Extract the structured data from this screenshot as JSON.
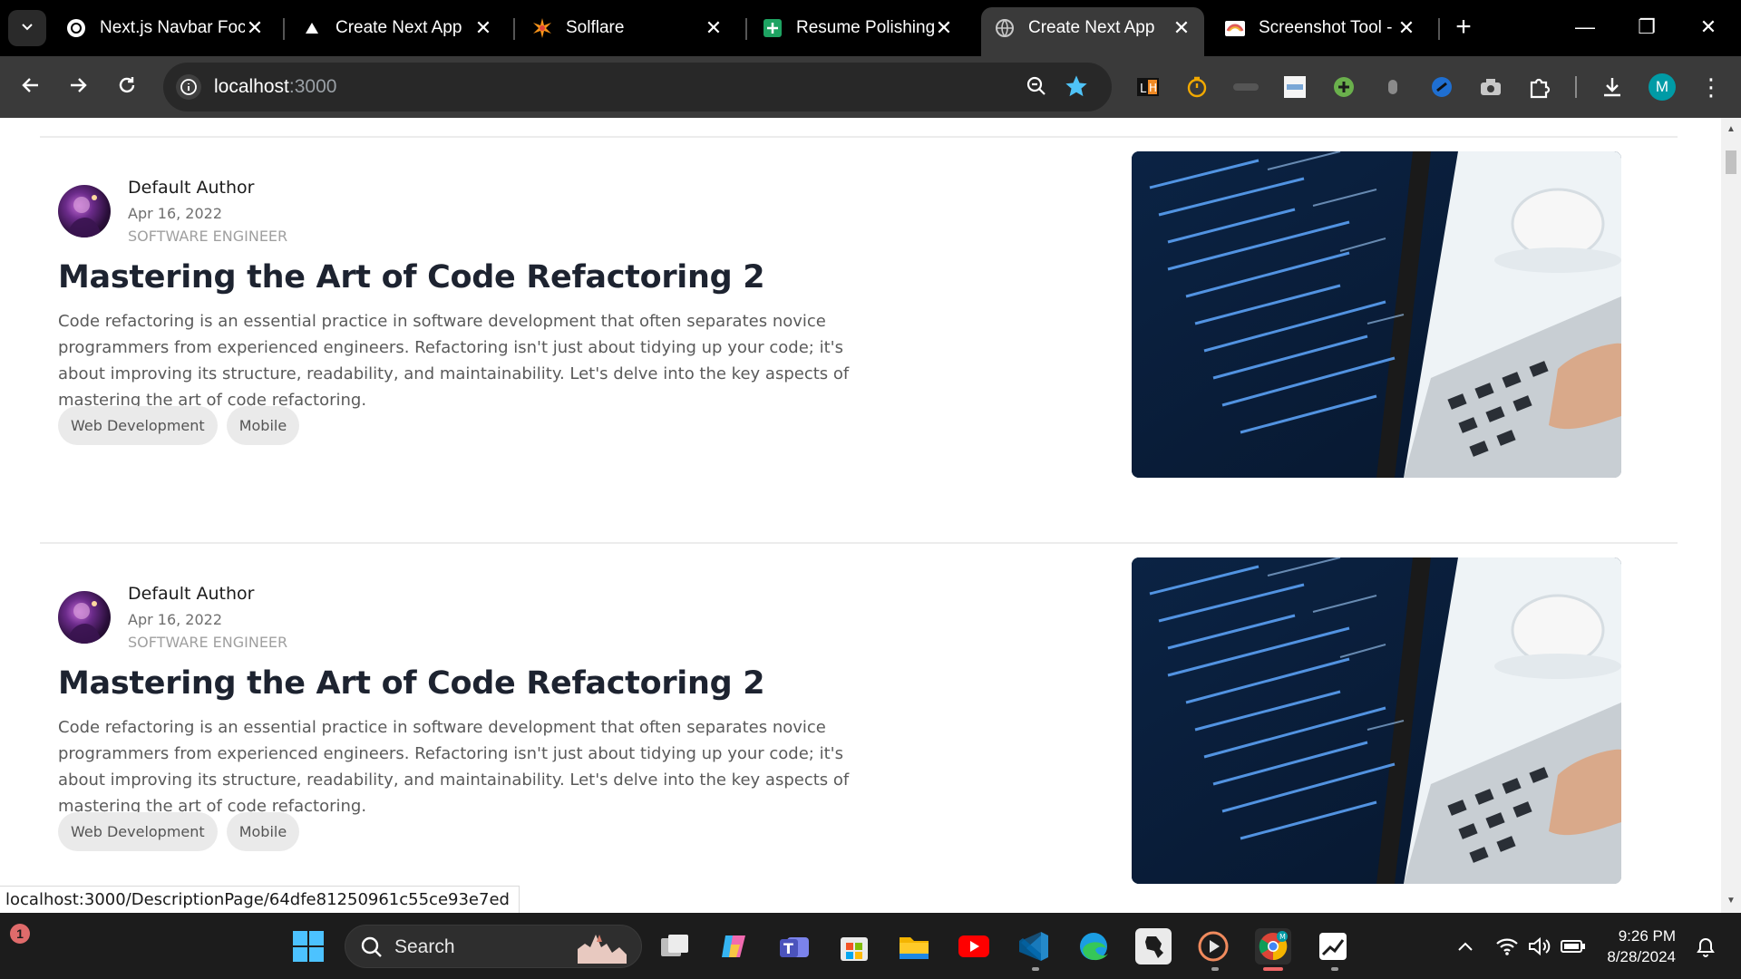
{
  "browser": {
    "tabs": [
      {
        "title": "Next.js Navbar Foc",
        "icon": "chatgpt-icon",
        "active": false
      },
      {
        "title": "Create Next App",
        "icon": "vercel-triangle-icon",
        "active": false
      },
      {
        "title": "Solflare",
        "icon": "solflare-icon",
        "active": false
      },
      {
        "title": "Resume Polishing",
        "icon": "sheets-icon",
        "active": false
      },
      {
        "title": "Create Next App",
        "icon": "globe-icon",
        "active": true
      },
      {
        "title": "Screenshot Tool -",
        "icon": "screenshot-tool-icon",
        "active": false
      }
    ],
    "close_glyph": "✕",
    "new_tab_glyph": "+",
    "window_controls": {
      "minimize": "—",
      "restore": "❐",
      "close": "✕"
    },
    "url_host": "localhost",
    "url_port": ":3000",
    "extensions": [
      "lighthouse-icon",
      "timer-icon",
      "fusv-icon",
      "apsv-icon",
      "green-plus-icon",
      "mouse-icon",
      "blue-circle-icon",
      "camera-icon",
      "puzzle-icon",
      "download-icon"
    ],
    "profile_initial": "M",
    "menu_glyph": "⋮"
  },
  "posts": [
    {
      "author": "Default Author",
      "date": "Apr 16, 2022",
      "role": "SOFTWARE ENGINEER",
      "title": "Mastering the Art of Code Refactoring 2",
      "excerpt": "Code refactoring is an essential practice in software development that often separates novice programmers from experienced engineers. Refactoring isn't just about tidying up your code; it's about improving its structure, readability, and maintainability. Let's delve into the key aspects of mastering the art of code refactoring.",
      "tags": [
        "Web Development",
        "Mobile"
      ]
    },
    {
      "author": "Default Author",
      "date": "Apr 16, 2022",
      "role": "SOFTWARE ENGINEER",
      "title": "Mastering the Art of Code Refactoring 2",
      "excerpt": "Code refactoring is an essential practice in software development that often separates novice programmers from experienced engineers. Refactoring isn't just about tidying up your code; it's about improving its structure, readability, and maintainability. Let's delve into the key aspects of mastering the art of code refactoring.",
      "tags": [
        "Web Development",
        "Mobile"
      ]
    }
  ],
  "status_url": "localhost:3000/DescriptionPage/64dfe81250961c55ce93e7ed",
  "taskbar": {
    "notification_count": "1",
    "search_label": "Search",
    "apps": [
      "windows-start-icon",
      "search-icon",
      "task-view-icon",
      "copilot-icon",
      "teams-icon",
      "store-icon",
      "file-explorer-icon",
      "youtube-icon",
      "vscode-icon",
      "edge-icon",
      "africa-map-icon",
      "media-player-icon",
      "chrome-icon",
      "stocks-icon"
    ],
    "time": "9:26 PM",
    "date": "8/28/2024"
  },
  "colors": {
    "accent_teal": "#009ba6",
    "star_blue": "#4fc3f7",
    "heading": "#1d2330",
    "tag_bg": "#eaeaea"
  }
}
